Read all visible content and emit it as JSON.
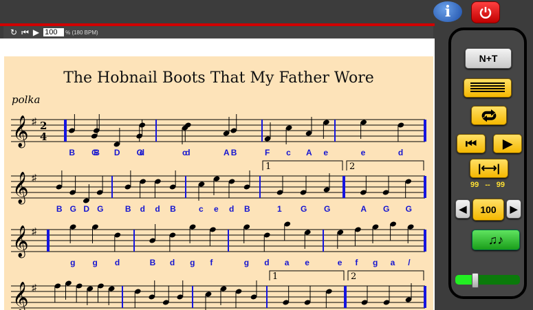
{
  "header": {
    "info_icon": "info-icon",
    "power_icon": "power-icon",
    "info_label": "i"
  },
  "toolbar": {
    "tempo_value": "100",
    "bpm_label": "% (180 BPM)"
  },
  "tune": {
    "title": "The Hobnail Boots That My Father Wore",
    "rhythm": "polka",
    "time_sig": [
      "2",
      "4"
    ],
    "rows": [
      {
        "measures": [
          [
            "B",
            "G",
            "D",
            "G"
          ],
          [
            "B",
            "d",
            "d",
            "B"
          ],
          [
            "c",
            "A",
            "F",
            "A"
          ],
          [
            "c",
            "e",
            "e",
            "d"
          ]
        ],
        "letters": true,
        "repeat_start": 0
      },
      {
        "measures": [
          [
            "B",
            "G",
            "D",
            "G"
          ],
          [
            "B",
            "d",
            "d",
            "B"
          ],
          [
            "c",
            "e",
            "d",
            "B"
          ],
          [
            "G",
            "G",
            "A"
          ],
          [
            "G",
            "G",
            "d"
          ]
        ],
        "labels": [
          [
            "B",
            "G",
            "D",
            "G"
          ],
          [
            "B",
            "d",
            "d",
            "B"
          ],
          [
            "c",
            "e",
            "d",
            "B"
          ],
          [
            "1",
            "G",
            "G"
          ],
          [
            "A",
            "G",
            "G"
          ]
        ],
        "letters": true,
        "repeat_end": 3,
        "endings": [
          "1",
          "2"
        ]
      },
      {
        "measures": [
          [
            "g",
            "g",
            "d"
          ],
          [
            "B",
            "d",
            "g",
            "f"
          ],
          [
            "g",
            "d",
            "a",
            "e"
          ],
          [
            "e",
            "f",
            "g",
            "a",
            "g"
          ]
        ],
        "labels": [
          [
            "g",
            "g",
            "d"
          ],
          [
            "B",
            "d",
            "g",
            "f"
          ],
          [
            "g",
            "d",
            "a",
            "e"
          ],
          [
            "e",
            "f",
            "g",
            "a",
            "/"
          ]
        ],
        "letters": true,
        "repeat_start": 0
      },
      {
        "measures": [
          [
            "f",
            "g",
            "f",
            "e",
            "f",
            "e"
          ],
          [
            "d",
            "B",
            "G",
            "B"
          ],
          [
            "c",
            "e",
            "d",
            "B"
          ],
          [
            "G",
            "G",
            "d"
          ],
          [
            "G",
            "G",
            "A"
          ]
        ],
        "letters": false,
        "repeat_end": 3,
        "endings": [
          "1",
          "2"
        ]
      }
    ]
  },
  "panel": {
    "nt_label": "N+T",
    "range_from": "99",
    "range_sep": "--",
    "range_to": "99",
    "speed_value": "100",
    "volume_fraction": 0.3,
    "accent": "#f5b800"
  }
}
